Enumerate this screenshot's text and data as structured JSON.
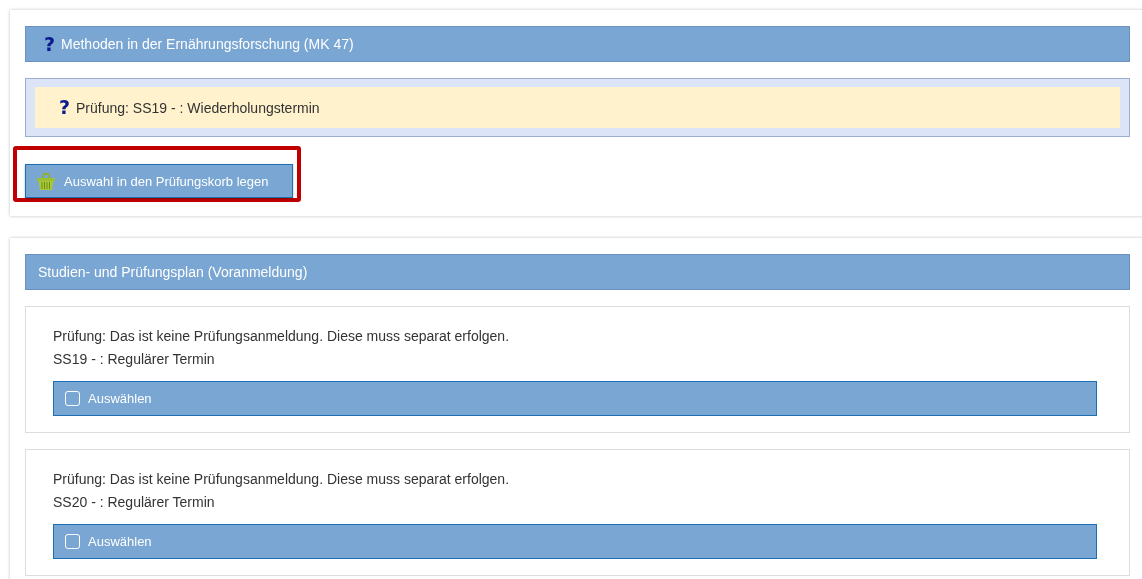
{
  "module_panel": {
    "title_icon": "?",
    "exam_icon": "?",
    "title": "Methoden in der Ernährungsforschung (MK 47)",
    "exam": "Prüfung: SS19 - : Wiederholungstermin",
    "basket_button": {
      "label": "Auswahl in den Prüfungskorb legen",
      "highlighted": true
    }
  },
  "plan_panel": {
    "title": "Studien- und Prüfungsplan (Voranmeldung)",
    "entries": [
      {
        "note": "Prüfung: Das ist keine Prüfungsanmeldung. Diese muss separat erfolgen.",
        "term": "SS19 - : Regulärer Termin",
        "select_label": "Auswählen",
        "checked": false
      },
      {
        "note": "Prüfung: Das ist keine Prüfungsanmeldung. Diese muss separat erfolgen.",
        "term": "SS20 - : Regulärer Termin",
        "select_label": "Auswählen",
        "checked": false
      }
    ]
  }
}
